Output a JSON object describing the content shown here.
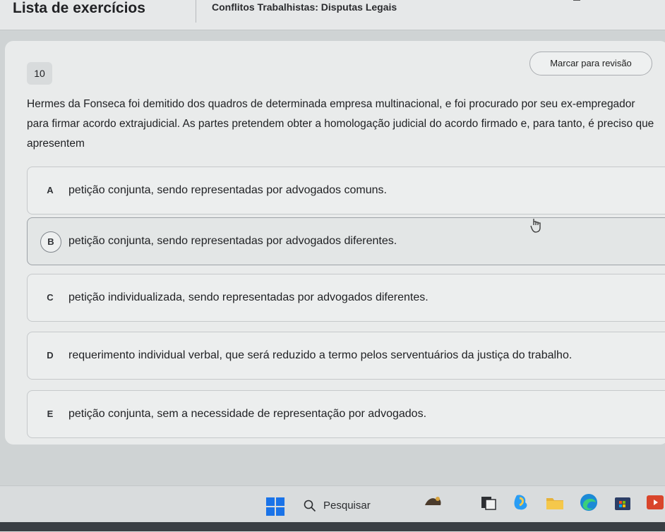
{
  "header": {
    "title": "Lista de exercícios",
    "subtitle": "Conflitos Trabalhistas: Disputas Legais"
  },
  "question": {
    "number": "10",
    "review_label": "Marcar para revisão",
    "text": "Hermes da Fonseca foi demitido dos quadros de determinada empresa multinacional, e foi procurado por seu ex-empregador para firmar acordo extrajudicial. As partes pretendem obter a homologação judicial do acordo firmado e, para tanto, é preciso que apresentem"
  },
  "options": [
    {
      "letter": "A",
      "text": "petição conjunta, sendo representadas por advogados comuns.",
      "selected": false
    },
    {
      "letter": "B",
      "text": "petição conjunta, sendo representadas por advogados diferentes.",
      "selected": true
    },
    {
      "letter": "C",
      "text": "petição individualizada, sendo representadas por advogados diferentes.",
      "selected": false
    },
    {
      "letter": "D",
      "text": "requerimento individual verbal, que será reduzido a termo pelos serventuários da justiça do trabalho.",
      "selected": false
    },
    {
      "letter": "E",
      "text": "petição conjunta, sem a necessidade de representação por advogados.",
      "selected": false
    }
  ],
  "taskbar": {
    "search_label": "Pesquisar",
    "icons": [
      "windows-start-icon",
      "search-icon",
      "widget-icon",
      "task-view-icon",
      "copilot-icon",
      "file-explorer-icon",
      "edge-icon",
      "store-icon",
      "media-icon"
    ]
  },
  "colors": {
    "card_bg": "#e9ebeb",
    "selected_border": "#7f858b",
    "taskbar_bg": "#d9dcdd"
  }
}
